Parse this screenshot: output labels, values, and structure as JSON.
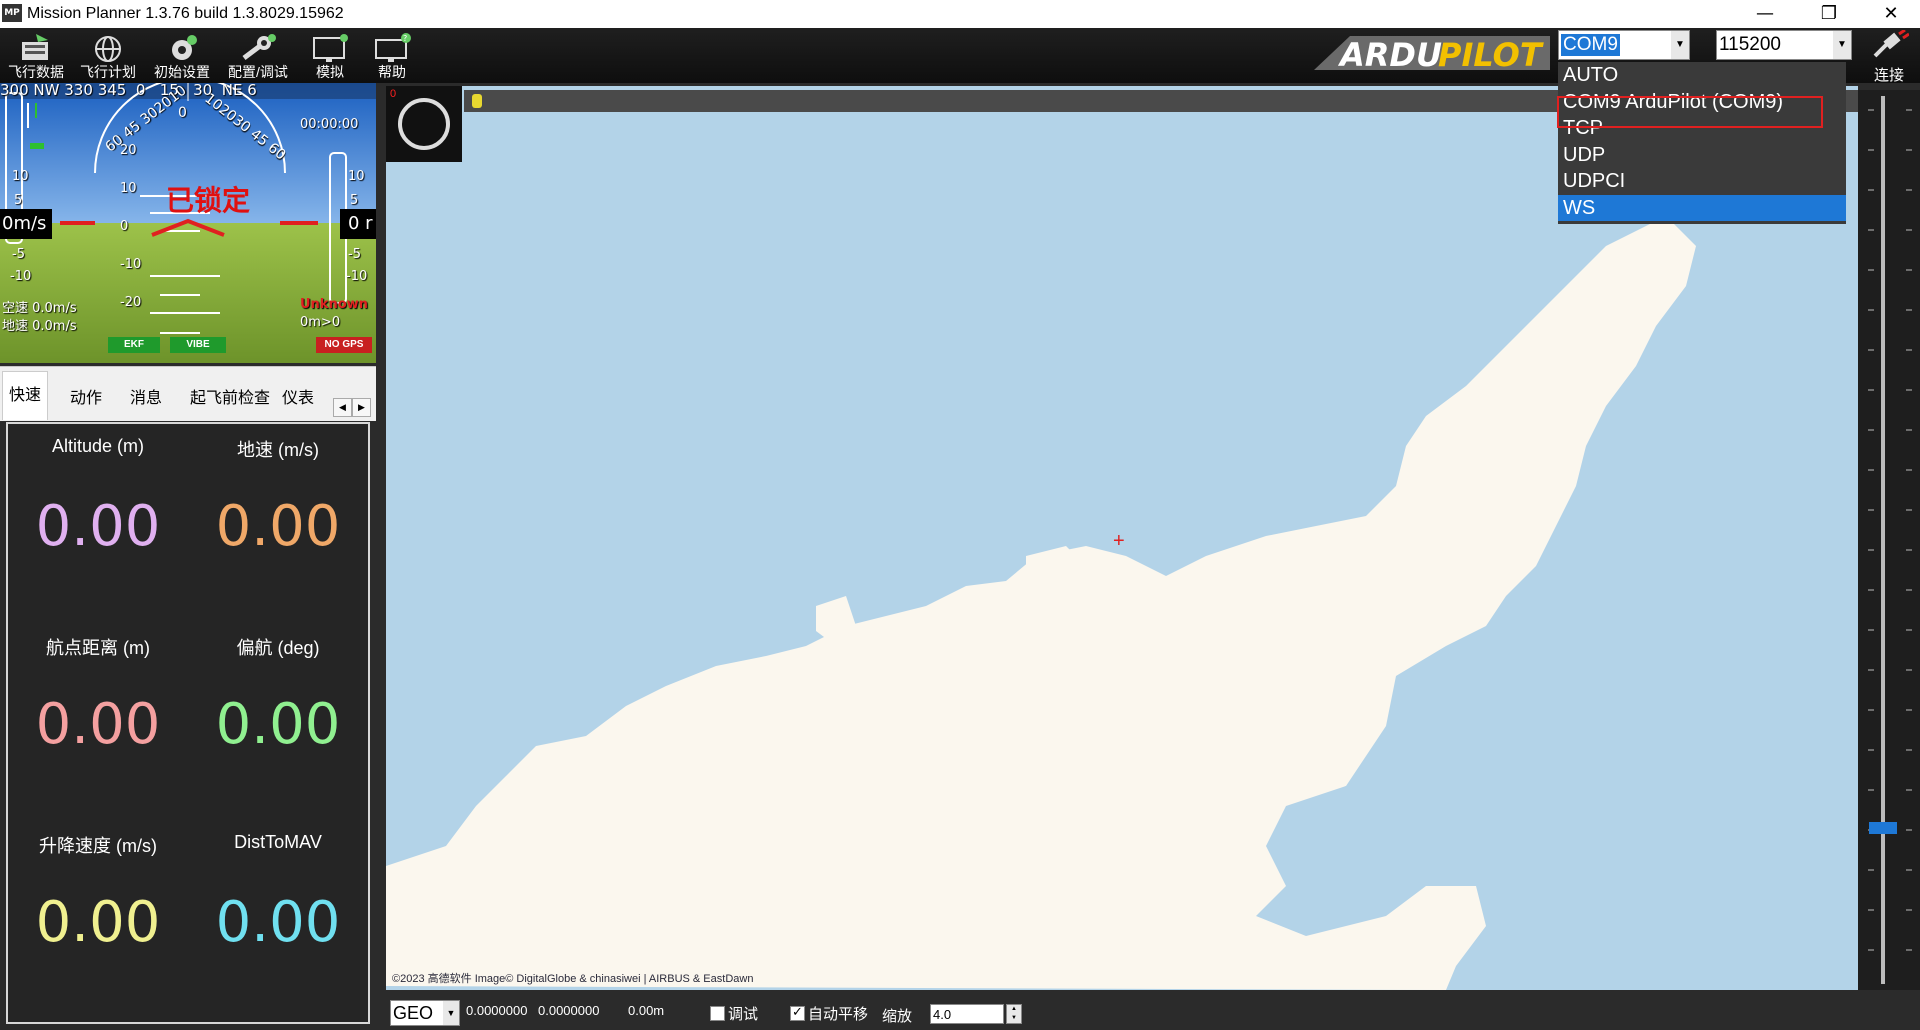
{
  "window": {
    "title": "Mission Planner 1.3.76 build 1.3.8029.15962",
    "icon_text": "MP",
    "minimize": "—",
    "restore": "❐",
    "close": "✕"
  },
  "toolbar": {
    "items": [
      {
        "label": "飞行数据",
        "icon": "flight-data-icon"
      },
      {
        "label": "飞行计划",
        "icon": "flight-plan-icon"
      },
      {
        "label": "初始设置",
        "icon": "initial-setup-icon"
      },
      {
        "label": "配置/调试",
        "icon": "config-tuning-icon"
      },
      {
        "label": "模拟",
        "icon": "simulation-icon"
      },
      {
        "label": "帮助",
        "icon": "help-icon"
      }
    ],
    "logo_text": "ARDUPILOT",
    "port_value": "COM9",
    "baud_value": "115200",
    "connect_label": "连接"
  },
  "port_dropdown": {
    "options": [
      "AUTO",
      "COM9 ArduPilot (COM9)",
      "TCP",
      "UDP",
      "UDPCI",
      "WS"
    ],
    "selected": "WS"
  },
  "hud": {
    "status_text": "已锁定",
    "heading_labels": [
      "300",
      "NW",
      "330",
      "345",
      "0",
      "15",
      "30",
      "NE",
      "6"
    ],
    "time": "00:00:00",
    "left_speed": "0m/s",
    "right_alt": "0 r",
    "airspeed": "空速 0.0m/s",
    "groundspeed": "地速 0.0m/s",
    "mode": "Unknown",
    "dist": "0m>0",
    "pitch_labels": [
      "20",
      "10",
      "0",
      "-10",
      "-20"
    ],
    "left_scale": [
      "10",
      "5",
      "-5",
      "-10"
    ],
    "right_scale": [
      "10",
      "5",
      "-5",
      "-10"
    ],
    "roll_labels": [
      "60",
      "45",
      "30",
      "20",
      "10",
      "0",
      "10",
      "20",
      "30",
      "45",
      "60"
    ],
    "ekf": "EKF",
    "vibe": "VIBE",
    "gps": "NO GPS",
    "colors": {
      "sky": "#1a5fc0",
      "ground": "#8fb83a",
      "status": "#e01010"
    }
  },
  "tabs": [
    {
      "label": "快速",
      "active": true
    },
    {
      "label": "动作",
      "active": false
    },
    {
      "label": "消息",
      "active": false
    },
    {
      "label": "起飞前检查",
      "active": false
    },
    {
      "label": "仪表",
      "active": false
    }
  ],
  "quick": [
    {
      "label": "Altitude (m)",
      "value": "0.00",
      "color": "#e0b0f0"
    },
    {
      "label": "地速 (m/s)",
      "value": "0.00",
      "color": "#f0a868"
    },
    {
      "label": "航点距离 (m)",
      "value": "0.00",
      "color": "#f4a0a0"
    },
    {
      "label": "偏航 (deg)",
      "value": "0.00",
      "color": "#90f090"
    },
    {
      "label": "升降速度 (m/s)",
      "value": "0.00",
      "color": "#f0f090"
    },
    {
      "label": "DistToMAV",
      "value": "0.00",
      "color": "#70e0f0"
    }
  ],
  "map": {
    "compass_zero": "0",
    "copyright": "©2023 高德软件 Image© DigitalGlobe & chinasiwei | AIRBUS & EastDawn",
    "crosshair": "+",
    "colors": {
      "water": "#b3d3e8",
      "land": "#fbf7ee"
    }
  },
  "statusbar": {
    "coord_system": "GEO",
    "lat": "0.0000000",
    "lon": "0.0000000",
    "alt": "0.00m",
    "debug_label": "调试",
    "auto_pan_label": "自动平移",
    "zoom_label": "缩放",
    "zoom_value": "4.0"
  }
}
